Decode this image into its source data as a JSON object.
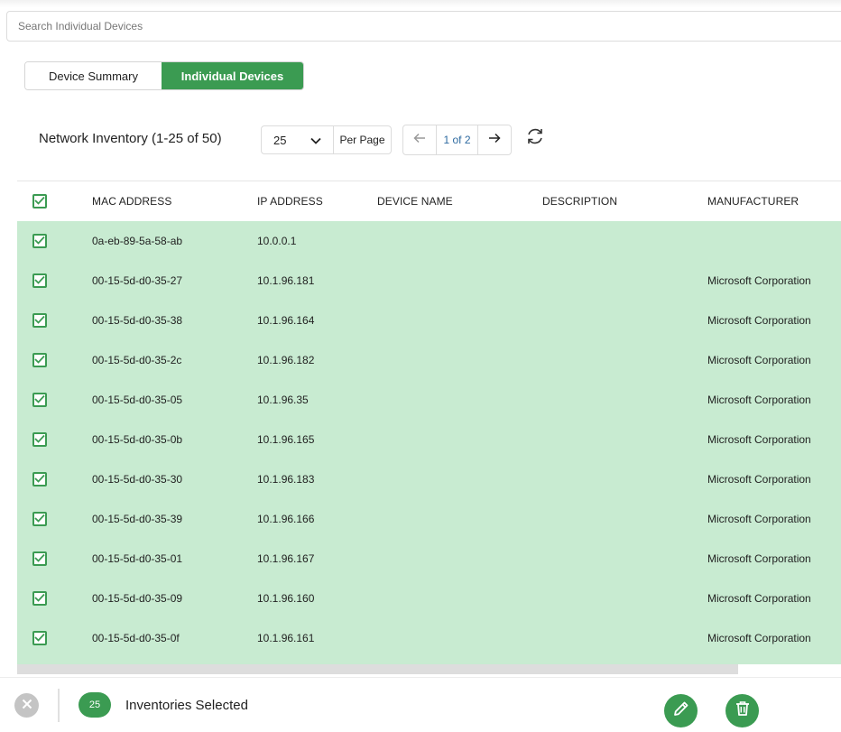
{
  "search": {
    "placeholder": "Search Individual Devices",
    "value": ""
  },
  "tabs": [
    {
      "label": "Device Summary",
      "active": false
    },
    {
      "label": "Individual Devices",
      "active": true
    }
  ],
  "inventory": {
    "title": "Network Inventory (1-25 of 50)",
    "per_page_value": "25",
    "per_page_label": "Per Page",
    "page_indicator": "1 of 2"
  },
  "table": {
    "columns": [
      "MAC ADDRESS",
      "IP ADDRESS",
      "DEVICE NAME",
      "DESCRIPTION",
      "MANUFACTURER"
    ],
    "rows": [
      {
        "mac": "0a-eb-89-5a-58-ab",
        "ip": "10.0.0.1",
        "name": "",
        "desc": "",
        "manufacturer": ""
      },
      {
        "mac": "00-15-5d-d0-35-27",
        "ip": "10.1.96.181",
        "name": "",
        "desc": "",
        "manufacturer": "Microsoft Corporation"
      },
      {
        "mac": "00-15-5d-d0-35-38",
        "ip": "10.1.96.164",
        "name": "",
        "desc": "",
        "manufacturer": "Microsoft Corporation"
      },
      {
        "mac": "00-15-5d-d0-35-2c",
        "ip": "10.1.96.182",
        "name": "",
        "desc": "",
        "manufacturer": "Microsoft Corporation"
      },
      {
        "mac": "00-15-5d-d0-35-05",
        "ip": "10.1.96.35",
        "name": "",
        "desc": "",
        "manufacturer": "Microsoft Corporation"
      },
      {
        "mac": "00-15-5d-d0-35-0b",
        "ip": "10.1.96.165",
        "name": "",
        "desc": "",
        "manufacturer": "Microsoft Corporation"
      },
      {
        "mac": "00-15-5d-d0-35-30",
        "ip": "10.1.96.183",
        "name": "",
        "desc": "",
        "manufacturer": "Microsoft Corporation"
      },
      {
        "mac": "00-15-5d-d0-35-39",
        "ip": "10.1.96.166",
        "name": "",
        "desc": "",
        "manufacturer": "Microsoft Corporation"
      },
      {
        "mac": "00-15-5d-d0-35-01",
        "ip": "10.1.96.167",
        "name": "",
        "desc": "",
        "manufacturer": "Microsoft Corporation"
      },
      {
        "mac": "00-15-5d-d0-35-09",
        "ip": "10.1.96.160",
        "name": "",
        "desc": "",
        "manufacturer": "Microsoft Corporation"
      },
      {
        "mac": "00-15-5d-d0-35-0f",
        "ip": "10.1.96.161",
        "name": "",
        "desc": "",
        "manufacturer": "Microsoft Corporation"
      }
    ]
  },
  "footer": {
    "selected_count": "25",
    "selected_label": "Inventories Selected"
  },
  "icons": {
    "per_page_toggle": "chevron-down-icon",
    "prev": "arrow-left-icon",
    "next": "arrow-right-icon",
    "refresh": "refresh-icon",
    "checkbox": "check-icon",
    "clear": "close-icon",
    "edit": "pencil-icon",
    "delete": "trash-icon"
  },
  "colors": {
    "accent": "#3b9b52",
    "selected_row": "#c8ebd1",
    "link": "#2e6aa0"
  }
}
